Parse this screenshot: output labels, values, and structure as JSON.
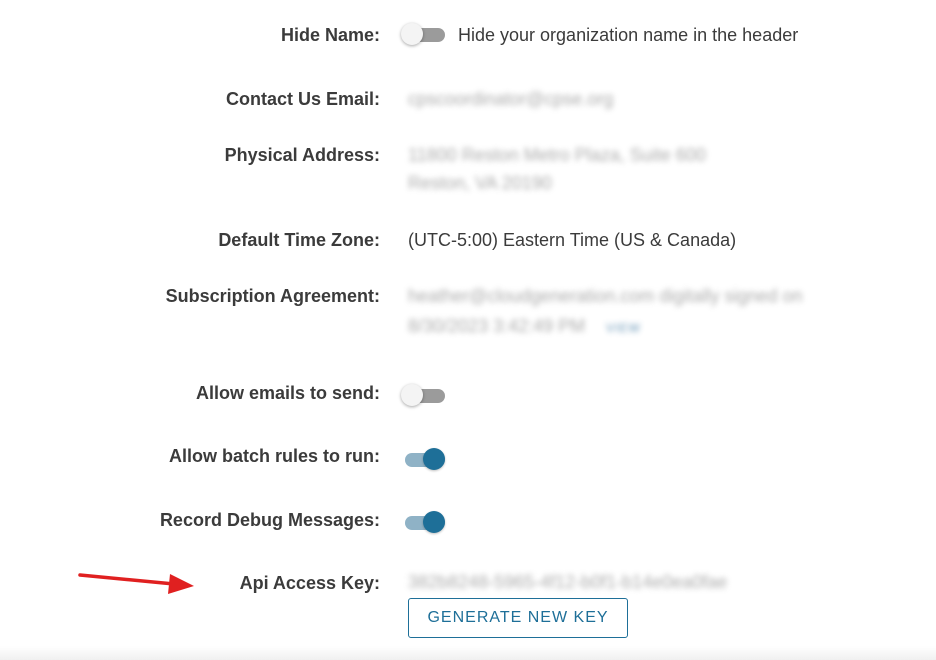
{
  "settings": {
    "hide_name": {
      "label": "Hide Name:",
      "hint": "Hide your organization name in the header",
      "enabled": false
    },
    "contact_email": {
      "label": "Contact Us Email:",
      "value": "cpscoordinator@cpse.org"
    },
    "physical_address": {
      "label": "Physical Address:",
      "line1": "11800 Reston Metro Plaza, Suite 600",
      "line2": "Reston, VA 20190"
    },
    "time_zone": {
      "label": "Default Time Zone:",
      "value": "(UTC-5:00) Eastern Time (US & Canada)"
    },
    "subscription": {
      "label": "Subscription Agreement:",
      "line1": "heather@cloudgeneration.com digitally signed on",
      "line2": "8/30/2023 3:42:49 PM",
      "view_label": "VIEW"
    },
    "allow_emails": {
      "label": "Allow emails to send:",
      "enabled": false
    },
    "allow_batch": {
      "label": "Allow batch rules to run:",
      "enabled": true
    },
    "record_debug": {
      "label": "Record Debug Messages:",
      "enabled": true
    },
    "api_key": {
      "label": "Api Access Key:",
      "value": "382b8248-5965-4f12-b0f1-b14e0ea0fae",
      "generate_label": "GENERATE NEW KEY"
    }
  },
  "colors": {
    "accent": "#1e6f98",
    "toggle_on_track": "#8fb2c6",
    "toggle_off_track": "#9b9b9b",
    "annotation_arrow": "#e02020"
  },
  "icons": {
    "annotation": "red-arrow-icon"
  }
}
